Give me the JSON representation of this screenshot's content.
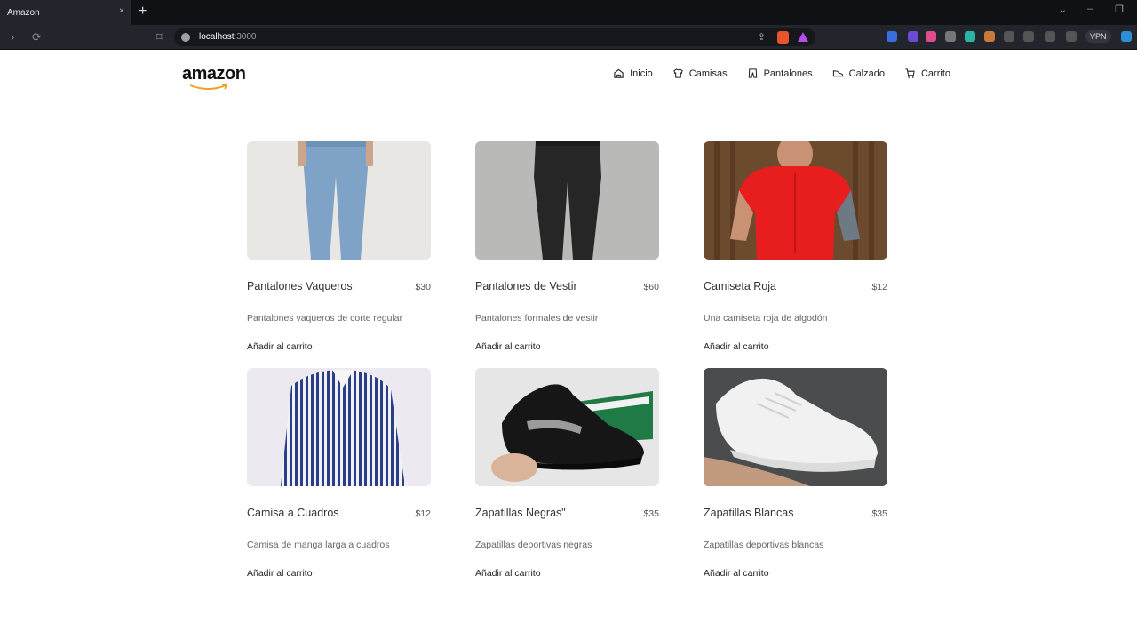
{
  "browser": {
    "tab_title": "Amazon",
    "close_glyph": "×",
    "newtab_glyph": "+",
    "url_host": "localhost",
    "url_port": ":3000",
    "vpn_label": "VPN"
  },
  "brand": {
    "logo_text": "amazon",
    "accent": "#f0a020"
  },
  "nav": {
    "items": [
      {
        "label": "Inicio",
        "icon": "home-icon"
      },
      {
        "label": "Camisas",
        "icon": "shirt-icon"
      },
      {
        "label": "Pantalones",
        "icon": "pants-icon"
      },
      {
        "label": "Calzado",
        "icon": "shoe-icon"
      },
      {
        "label": "Carrito",
        "icon": "cart-icon"
      }
    ]
  },
  "products": [
    {
      "name": "Pantalones Vaqueros",
      "price": "$30",
      "description": "Pantalones vaqueros de corte regular",
      "cta": "Añadir al carrito"
    },
    {
      "name": "Pantalones de Vestir",
      "price": "$60",
      "description": "Pantalones formales de vestir",
      "cta": "Añadir al carrito"
    },
    {
      "name": "Camiseta Roja",
      "price": "$12",
      "description": "Una camiseta roja de algodón",
      "cta": "Añadir al carrito"
    },
    {
      "name": "Camisa a Cuadros",
      "price": "$12",
      "description": "Camisa de manga larga a cuadros",
      "cta": "Añadir al carrito"
    },
    {
      "name": "Zapatillas Negras\"",
      "price": "$35",
      "description": "Zapatillas deportivas negras",
      "cta": "Añadir al carrito"
    },
    {
      "name": "Zapatillas Blancas",
      "price": "$35",
      "description": "Zapatillas deportivas blancas",
      "cta": "Añadir al carrito"
    }
  ]
}
